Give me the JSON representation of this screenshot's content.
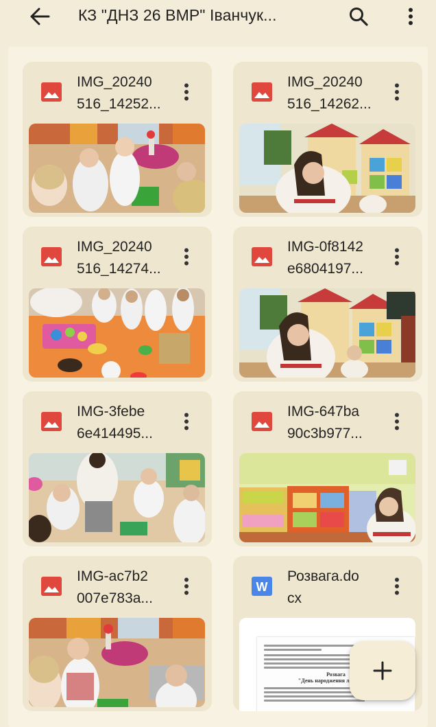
{
  "header": {
    "title": "КЗ \"ДНЗ 26 ВМР\" Іванчук..."
  },
  "files": [
    {
      "name": "IMG_20240\n516_14252...",
      "type": "image"
    },
    {
      "name": "IMG_20240\n516_14262...",
      "type": "image"
    },
    {
      "name": "IMG_20240\n516_14274...",
      "type": "image"
    },
    {
      "name": "IMG-0f8142\ne6804197...",
      "type": "image"
    },
    {
      "name": "IMG-3febe\n6e414495...",
      "type": "image"
    },
    {
      "name": "IMG-647ba\n90c3b977...",
      "type": "image"
    },
    {
      "name": "IMG-ac7b2\n007e783a...",
      "type": "image"
    },
    {
      "name": "Розвага.do\ncx",
      "type": "word"
    }
  ],
  "doc_preview": {
    "title": "Розвага",
    "subtitle": "\"День народження ляльки Ма"
  },
  "icons": {
    "back": "arrow-back-icon",
    "search": "search-icon",
    "more": "more-vert-icon",
    "image_file": "image-file-icon",
    "word_file": "word-file-icon",
    "add": "add-icon"
  },
  "colors": {
    "background": "#f3ecd9",
    "card": "#efe6cf",
    "image_icon": "#e0483e",
    "word_icon": "#4a86e8"
  }
}
